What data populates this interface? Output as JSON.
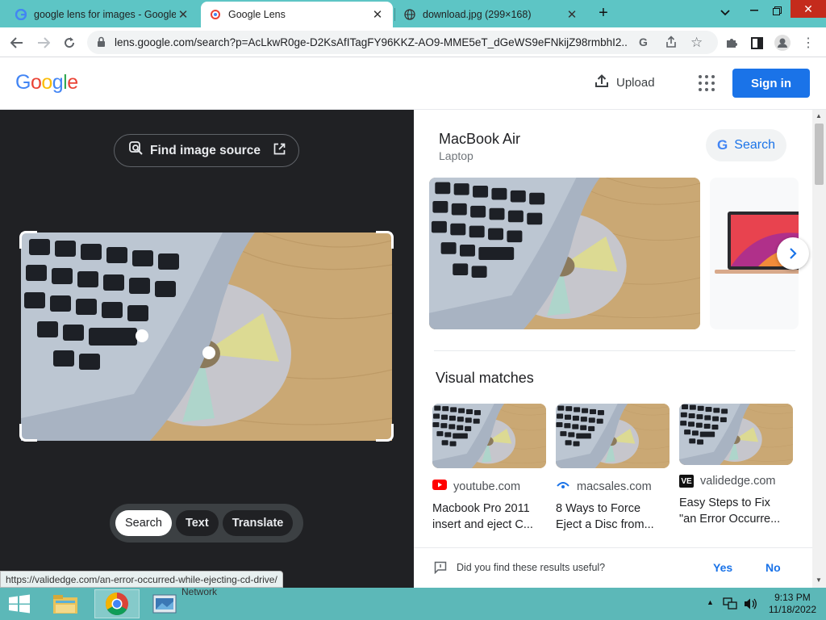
{
  "tabs": [
    {
      "title": "google lens for images - Google",
      "active": false
    },
    {
      "title": "Google Lens",
      "active": true
    },
    {
      "title": "download.jpg (299×168)",
      "active": false
    }
  ],
  "address_bar": {
    "url": "lens.google.com/search?p=AcLkwR0ge-D2KsAfITagFY96KKZ-AO9-MME5eT_dGeWS9eFNkijZ98rmbhI2..."
  },
  "header": {
    "logo": "Google",
    "upload_label": "Upload",
    "signin_label": "Sign in"
  },
  "left_pane": {
    "find_source_label": "Find image source",
    "modes": [
      "Search",
      "Text",
      "Translate"
    ],
    "active_mode": "Search"
  },
  "status_url": "https://validedge.com/an-error-occurred-while-ejecting-cd-drive/",
  "knowledge": {
    "title": "MacBook Air",
    "subtitle": "Laptop",
    "search_label": "Search"
  },
  "visual_matches": {
    "heading": "Visual matches",
    "items": [
      {
        "source": "youtube.com",
        "caption_1": "Macbook Pro 2011",
        "caption_2": "insert and eject C..."
      },
      {
        "source": "macsales.com",
        "caption_1": "8 Ways to Force",
        "caption_2": "Eject a Disc from..."
      },
      {
        "source": "validedge.com",
        "caption_1": "Easy Steps to Fix",
        "caption_2": "\"an Error Occurre..."
      }
    ]
  },
  "feedback": {
    "question": "Did you find these results useful?",
    "yes": "Yes",
    "no": "No"
  },
  "taskbar": {
    "network_label": "Network",
    "time": "9:13 PM",
    "date": "11/18/2022"
  },
  "colors": {
    "accent": "#1a73e8",
    "dark_bg": "#202124",
    "tabstrip": "#5dc5c5",
    "taskbar": "#5cb8b8"
  }
}
